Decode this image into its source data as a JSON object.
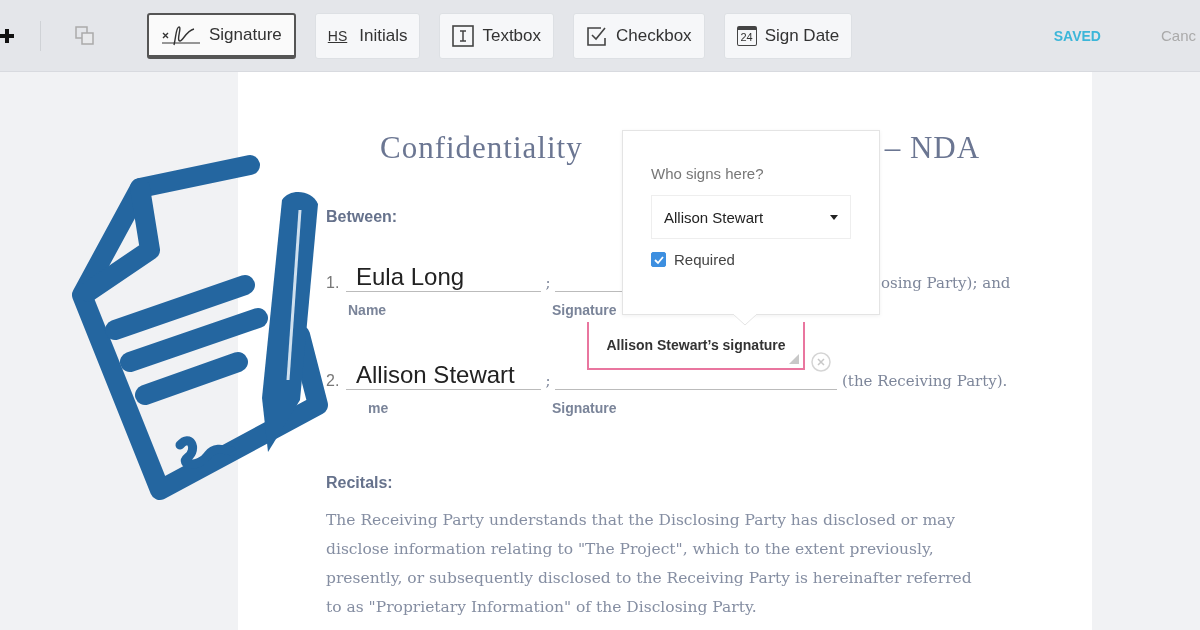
{
  "toolbar": {
    "tools": [
      {
        "kind": "signature",
        "label": "Signature",
        "selected": true
      },
      {
        "kind": "initials",
        "label": "Initials",
        "icon_text": "HS",
        "selected": false
      },
      {
        "kind": "textbox",
        "label": "Textbox",
        "selected": false
      },
      {
        "kind": "checkbox",
        "label": "Checkbox",
        "selected": false
      },
      {
        "kind": "date",
        "label": "Sign Date",
        "icon_text": "24",
        "selected": false
      }
    ],
    "status": "SAVED",
    "cancel": "Canc"
  },
  "document": {
    "title_left": "Confidentiality",
    "title_right": "– NDA",
    "between": "Between:",
    "parties": [
      {
        "number": "1.",
        "name": "Eula Long",
        "separator": ";",
        "name_label": "Name",
        "signature_label": "Signature",
        "trailing": "osing Party); and"
      },
      {
        "number": "2.",
        "name": "Allison Stewart",
        "separator": ";",
        "name_label": "me",
        "signature_label": "Signature",
        "trailing": "(the Receiving Party).",
        "signature_field": {
          "text": "Allison Stewart’s signature"
        }
      }
    ],
    "recitals_heading": "Recitals:",
    "recitals_text": "The Receiving Party understands that the Disclosing Party has disclosed or may disclose information relating to \"The Project\", which to the extent previously, presently, or subsequently disclosed to the Receiving Party is hereinafter referred to as \"Proprietary Information\" of the Disclosing Party."
  },
  "popover": {
    "question": "Who signs here?",
    "assignee": "Allison Stewart",
    "required": {
      "label": "Required",
      "checked": true
    }
  }
}
